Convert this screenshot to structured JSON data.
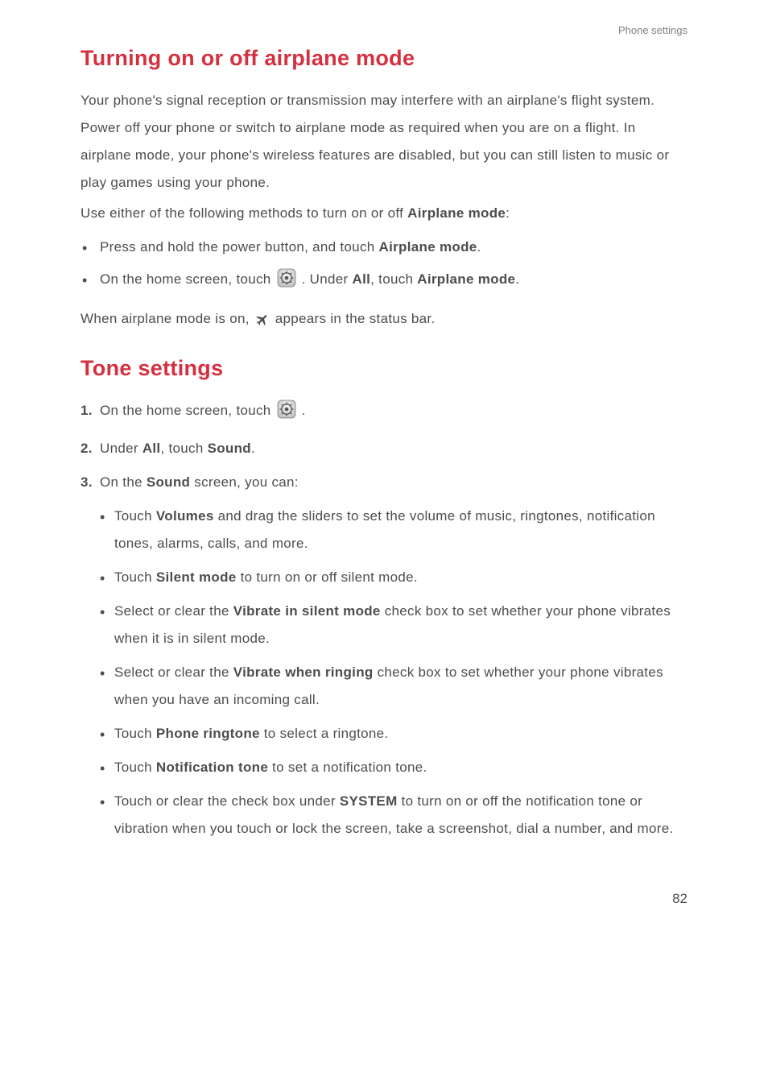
{
  "header": {
    "section_label": "Phone settings"
  },
  "section1": {
    "title": "Turning on or off airplane mode",
    "para1": "Your phone's signal reception or transmission may interfere with an airplane's flight system. Power off your phone or switch to airplane mode as required when you are on a flight. In airplane mode, your phone's wireless features are disabled, but you can still listen to music or play games using your phone.",
    "para2_pre": "Use either of the following methods to turn on or off ",
    "para2_bold": "Airplane mode",
    "para2_post": ":",
    "bullet1_pre": "Press and hold the power button, and touch ",
    "bullet1_bold": "Airplane mode",
    "bullet1_post": ".",
    "bullet2_pre": "On the home screen, touch ",
    "bullet2_mid": " . Under ",
    "bullet2_bold_all": "All",
    "bullet2_mid2": ", touch ",
    "bullet2_bold_mode": "Airplane mode",
    "bullet2_post": ".",
    "status_pre": "When airplane mode is on, ",
    "status_post": " appears in the status bar."
  },
  "section2": {
    "title": "Tone settings",
    "step1_pre": "On the home screen, touch ",
    "step1_post": " .",
    "step2_pre": "Under ",
    "step2_all": "All",
    "step2_mid": ", touch ",
    "step2_sound": "Sound",
    "step2_post": ".",
    "step3_pre": "On the ",
    "step3_sound": "Sound",
    "step3_post": " screen, you can:",
    "sub": {
      "i1_pre": "Touch ",
      "i1_bold": "Volumes",
      "i1_post": " and drag the sliders to set the volume of music, ringtones, notification tones, alarms, calls, and more.",
      "i2_pre": "Touch ",
      "i2_bold": "Silent mode",
      "i2_post": " to turn on or off silent mode.",
      "i3_pre": "Select or clear the ",
      "i3_bold": "Vibrate in silent mode",
      "i3_post": " check box to set whether your phone vibrates when it is in silent mode.",
      "i4_pre": "Select or clear the ",
      "i4_bold": "Vibrate when ringing",
      "i4_post": " check box to set whether your phone vibrates when you have an incoming call.",
      "i5_pre": "Touch ",
      "i5_bold": "Phone ringtone",
      "i5_post": " to select a ringtone.",
      "i6_pre": "Touch ",
      "i6_bold": "Notification tone",
      "i6_post": " to set a notification tone.",
      "i7_pre": "Touch or clear the check box under ",
      "i7_bold": "SYSTEM",
      "i7_post": " to turn on or off the notification tone or vibration when you touch or lock the screen, take a screenshot, dial a number, and more."
    }
  },
  "footer": {
    "page": "82"
  }
}
